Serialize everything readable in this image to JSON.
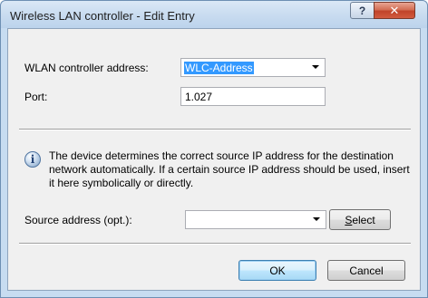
{
  "window": {
    "title": "Wireless LAN controller - Edit Entry",
    "help_glyph": "?",
    "close_glyph": "✕"
  },
  "form": {
    "controller_address_label": "WLAN controller address:",
    "controller_address_value": "WLC-Address",
    "port_label": "Port:",
    "port_value": "1.027"
  },
  "info": {
    "icon_glyph": "i",
    "text": "The device determines the correct source IP address for the destination network automatically. If a certain source IP address should be used, insert it here symbolically or directly."
  },
  "source": {
    "label": "Source address (opt.):",
    "value": "",
    "select_label_underlined": "S",
    "select_label_rest": "elect"
  },
  "buttons": {
    "ok_label": "OK",
    "cancel_label": "Cancel"
  }
}
